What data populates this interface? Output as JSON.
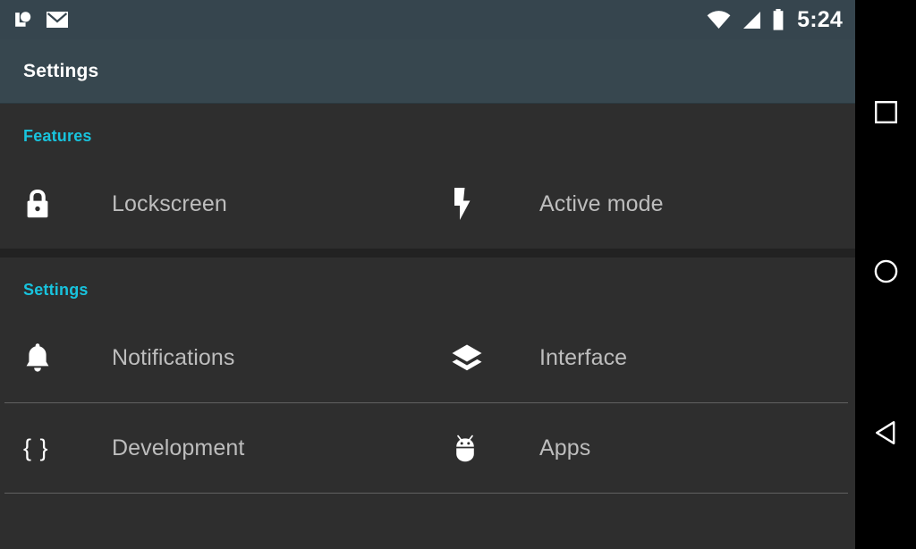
{
  "status_bar": {
    "notification_icons": [
      {
        "name": "chat-bubble-icon",
        "label": "Messages"
      },
      {
        "name": "email-envelope-icon",
        "label": "Email"
      }
    ],
    "system_icons": [
      {
        "name": "wifi-icon",
        "label": "Wi-Fi"
      },
      {
        "name": "cellular-signal-icon",
        "label": "Cellular signal"
      },
      {
        "name": "battery-icon",
        "label": "Battery"
      }
    ],
    "time": "5:24",
    "background_color": "#36454e"
  },
  "action_bar": {
    "title": "Settings",
    "background_color": "#37474f",
    "title_color": "#ffffff"
  },
  "theme": {
    "accent_color": "#18c3dd",
    "content_background": "#2e2e2e",
    "label_color": "#bdbdbd",
    "icon_color": "#ffffff",
    "divider_color": "#6a6a6a",
    "section_gap_color": "#222222"
  },
  "sections": [
    {
      "header": "Features",
      "rows": [
        [
          {
            "label": "Lockscreen",
            "icon": "lock-icon"
          },
          {
            "label": "Active mode",
            "icon": "flash-bolt-icon"
          }
        ]
      ]
    },
    {
      "header": "Settings",
      "rows": [
        [
          {
            "label": "Notifications",
            "icon": "bell-icon"
          },
          {
            "label": "Interface",
            "icon": "layers-icon"
          }
        ],
        [
          {
            "label": "Development",
            "icon": "curly-braces-icon"
          },
          {
            "label": "Apps",
            "icon": "android-robot-icon"
          }
        ]
      ]
    }
  ],
  "navigation_bar": {
    "buttons": [
      {
        "name": "recents-button",
        "label": "Recents",
        "glyph": "square"
      },
      {
        "name": "home-button",
        "label": "Home",
        "glyph": "circle"
      },
      {
        "name": "back-button",
        "label": "Back",
        "glyph": "triangle"
      }
    ],
    "background_color": "#000000"
  }
}
